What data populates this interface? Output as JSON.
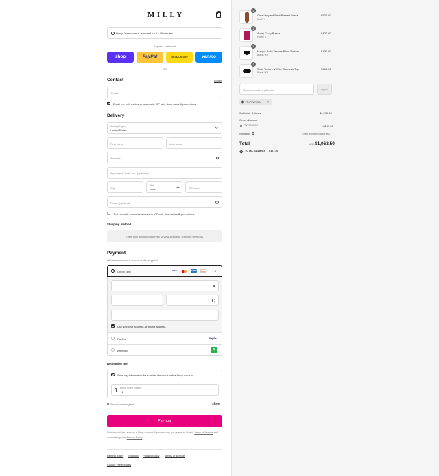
{
  "brand": {
    "logo": "MILLY"
  },
  "timer": {
    "text": "Hurry! Your order is reserved for 14:45 minutes"
  },
  "express": {
    "label": "Express checkout",
    "buttons": [
      {
        "label": "shop",
        "color": "#5a31f4"
      },
      {
        "label": "PayPal",
        "color": "#ffc439"
      },
      {
        "label": "amazon pay",
        "color": "#ffd814"
      },
      {
        "label": "venmo",
        "color": "#008cff"
      }
    ],
    "or": "OR"
  },
  "contact": {
    "title": "Contact",
    "login": "Log in",
    "email_placeholder": "Email",
    "marketing": "Email me with exclusive access to VIP only flash sales & promotions"
  },
  "delivery": {
    "title": "Delivery",
    "country_label": "Country/Region",
    "country_value": "United States",
    "first_name": "First name",
    "last_name": "Last name",
    "address": "Address",
    "apartment": "Apartment, suite, etc. (optional)",
    "city": "City",
    "state_label": "State",
    "state_value": "Iowa",
    "zip": "ZIP code",
    "phone": "Phone (optional)",
    "text_me": "Text me with exclusive access to VIP only flash sales & promotions"
  },
  "shipping": {
    "title": "Shipping method",
    "notice": "Enter your shipping address to view available shipping methods."
  },
  "payment": {
    "title": "Payment",
    "subtitle": "All transactions are secure and encrypted.",
    "credit_card": "Credit card",
    "card_logos": [
      "VISA",
      "MC",
      "AMEX",
      "DISC"
    ],
    "more": "+3",
    "billing_same": "Use shipping address as billing address",
    "paypal": "PayPal",
    "paypal_logo": "PayPal",
    "afterpay": "Afterpay",
    "afterpay_logo": "$"
  },
  "remember": {
    "title": "Remember me",
    "save": "Save my information for a faster checkout with a Shop account",
    "phone_label": "Mobile phone number",
    "phone_value": "+1",
    "secure": "Secure and encrypted",
    "shop_logo": "shop"
  },
  "pay_now": "Pay now",
  "legal": {
    "prefix": "Your info will be saved to a Shop account. By continuing, you agree to Shop's ",
    "terms": "Terms of Service",
    "middle": " and acknowledge the ",
    "privacy": "Privacy Policy",
    "suffix": "."
  },
  "footer": {
    "links": [
      "Refund policy",
      "Shipping",
      "Privacy policy",
      "Terms of service"
    ],
    "cookie": "Cookie Preferences"
  },
  "order": {
    "items": [
      {
        "name": "Gina Leopard Print Pleated Dress",
        "variant": "Multi / 0",
        "price": "$525.00",
        "qty": "1",
        "color": "#8a4a2c"
      },
      {
        "name": "Avery Cady Blazer",
        "variant": "Plum / 0",
        "price": "$425.00",
        "qty": "1",
        "color": "#b0185a"
      },
      {
        "name": "Margot Solid Texture Bikini Bottom",
        "variant": "Black / XS",
        "price": "$130.00",
        "qty": "1",
        "color": "#111111"
      },
      {
        "name": "Solid Texture V-Wire Bandeau Top",
        "variant": "Black / XS",
        "price": "$150.00",
        "qty": "1",
        "color": "#111111"
      }
    ],
    "discount_placeholder": "Discount code or gift card",
    "apply": "Apply",
    "code": "TXTVWYBEJ",
    "subtotal_label": "Subtotal · 4 items",
    "subtotal_value": "$1,230.00",
    "order_discount_label": "Order discount",
    "order_discount_code": "TXTVWYBEJ",
    "order_discount_value": "-$167.50",
    "shipping_label": "Shipping",
    "shipping_value": "Enter shipping address",
    "total_label": "Total",
    "currency": "USD",
    "total_value": "$1,062.50",
    "savings_label": "TOTAL SAVINGS",
    "savings_value": "$167.50"
  }
}
